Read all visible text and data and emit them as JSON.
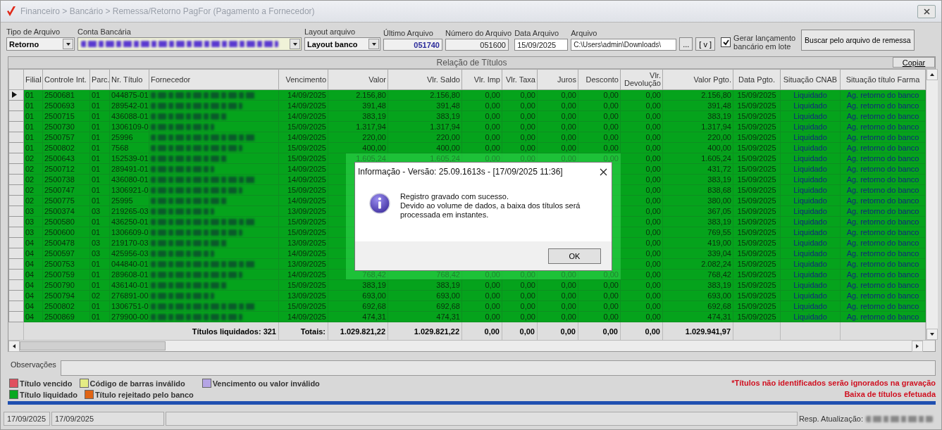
{
  "window": {
    "title": "Financeiro > Bancário > Remessa/Retorno PagFor (Pagamento  a Fornecedor)"
  },
  "filters": {
    "tipo_arquivo": {
      "label": "Tipo de Arquivo",
      "value": "Retorno"
    },
    "conta_bancaria": {
      "label": "Conta Bancária"
    },
    "layout_arquivo": {
      "label": "Layout arquivo",
      "value": "Layout banco"
    },
    "ultimo_arquivo": {
      "label": "Último Arquivo",
      "value": "051740"
    },
    "numero_arquivo": {
      "label": "Número do Arquivo",
      "value": "051600"
    },
    "data_arquivo": {
      "label": "Data Arquivo",
      "value": "15/09/2025"
    },
    "arquivo": {
      "label": "Arquivo",
      "value": "C:\\Users\\admin\\Downloads\\"
    },
    "browse_button": "...",
    "view_button": "[ v ]",
    "gerar_lote": {
      "label": "Gerar lançamento bancário em lote",
      "checked": true
    },
    "buscar_button": "Buscar pelo arquivo de remessa"
  },
  "table": {
    "title": "Relação de Títulos",
    "copy_button": "Copiar",
    "columns": [
      {
        "label": "Filial"
      },
      {
        "label": "Controle Int."
      },
      {
        "label": "Parc."
      },
      {
        "label": "Nr. Título"
      },
      {
        "label": "Fornecedor"
      },
      {
        "label": "Vencimento"
      },
      {
        "label": "Valor"
      },
      {
        "label": "Vlr. Saldo"
      },
      {
        "label": "Vlr. Imp"
      },
      {
        "label": "Vlr. Taxa"
      },
      {
        "label": "Juros"
      },
      {
        "label": "Desconto"
      },
      {
        "label": "Vlr. Devolução"
      },
      {
        "label": "Valor Pgto."
      },
      {
        "label": "Data Pgto."
      },
      {
        "label": "Situação CNAB"
      },
      {
        "label": "Situação título Farma"
      }
    ],
    "rows": [
      {
        "selected": true,
        "cells": [
          "01",
          "2500681",
          "01",
          "044875-01",
          null,
          "14/09/2025",
          "2.156,80",
          "2.156,80",
          "0,00",
          "0,00",
          "0,00",
          "0,00",
          "0,00",
          "2.156,80",
          "15/09/2025",
          "Liquidado",
          "Ag. retorno do banco"
        ]
      },
      {
        "selected": false,
        "cells": [
          "01",
          "2500693",
          "01",
          "289542-01",
          null,
          "14/09/2025",
          "391,48",
          "391,48",
          "0,00",
          "0,00",
          "0,00",
          "0,00",
          "0,00",
          "391,48",
          "15/09/2025",
          "Liquidado",
          "Ag. retorno do banco"
        ]
      },
      {
        "selected": false,
        "cells": [
          "01",
          "2500715",
          "01",
          "436088-01",
          null,
          "14/09/2025",
          "383,19",
          "383,19",
          "0,00",
          "0,00",
          "0,00",
          "0,00",
          "0,00",
          "383,19",
          "15/09/2025",
          "Liquidado",
          "Ag. retorno do banco"
        ]
      },
      {
        "selected": false,
        "cells": [
          "01",
          "2500730",
          "01",
          "1306109-0",
          null,
          "15/09/2025",
          "1.317,94",
          "1.317,94",
          "0,00",
          "0,00",
          "0,00",
          "0,00",
          "0,00",
          "1.317,94",
          "15/09/2025",
          "Liquidado",
          "Ag. retorno do banco"
        ]
      },
      {
        "selected": false,
        "cells": [
          "01",
          "2500757",
          "01",
          "25996",
          null,
          "14/09/2025",
          "220,00",
          "220,00",
          "0,00",
          "0,00",
          "0,00",
          "0,00",
          "0,00",
          "220,00",
          "15/09/2025",
          "Liquidado",
          "Ag. retorno do banco"
        ]
      },
      {
        "selected": false,
        "cells": [
          "01",
          "2500802",
          "01",
          "7568",
          null,
          "15/09/2025",
          "400,00",
          "400,00",
          "0,00",
          "0,00",
          "0,00",
          "0,00",
          "0,00",
          "400,00",
          "15/09/2025",
          "Liquidado",
          "Ag. retorno do banco"
        ]
      },
      {
        "selected": false,
        "cells": [
          "02",
          "2500643",
          "01",
          "152539-01",
          null,
          "15/09/2025",
          "1.605,24",
          "1.605,24",
          "0,00",
          "0,00",
          "0,00",
          "0,00",
          "0,00",
          "1.605,24",
          "15/09/2025",
          "Liquidado",
          "Ag. retorno do banco"
        ]
      },
      {
        "selected": false,
        "cells": [
          "02",
          "2500712",
          "01",
          "289491-01",
          null,
          "14/09/2025",
          null,
          null,
          null,
          null,
          null,
          null,
          "0,00",
          "431,72",
          "15/09/2025",
          "Liquidado",
          "Ag. retorno do banco"
        ]
      },
      {
        "selected": false,
        "cells": [
          "02",
          "2500738",
          "01",
          "436080-01",
          null,
          "14/09/2025",
          null,
          null,
          null,
          null,
          null,
          null,
          "0,00",
          "383,19",
          "15/09/2025",
          "Liquidado",
          "Ag. retorno do banco"
        ]
      },
      {
        "selected": false,
        "cells": [
          "02",
          "2500747",
          "01",
          "1306921-0",
          null,
          "15/09/2025",
          null,
          null,
          null,
          null,
          null,
          null,
          "0,00",
          "838,68",
          "15/09/2025",
          "Liquidado",
          "Ag. retorno do banco"
        ]
      },
      {
        "selected": false,
        "cells": [
          "02",
          "2500775",
          "01",
          "25995",
          null,
          "14/09/2025",
          null,
          null,
          null,
          null,
          null,
          null,
          "0,00",
          "380,00",
          "15/09/2025",
          "Liquidado",
          "Ag. retorno do banco"
        ]
      },
      {
        "selected": false,
        "cells": [
          "03",
          "2500374",
          "03",
          "219265-03",
          null,
          "13/09/2025",
          null,
          null,
          null,
          null,
          null,
          null,
          "0,00",
          "367,05",
          "15/09/2025",
          "Liquidado",
          "Ag. retorno do banco"
        ]
      },
      {
        "selected": false,
        "cells": [
          "03",
          "2500580",
          "01",
          "436250-01",
          null,
          "15/09/2025",
          null,
          null,
          null,
          null,
          null,
          null,
          "0,00",
          "383,19",
          "15/09/2025",
          "Liquidado",
          "Ag. retorno do banco"
        ]
      },
      {
        "selected": false,
        "cells": [
          "03",
          "2500600",
          "01",
          "1306609-0",
          null,
          "15/09/2025",
          null,
          null,
          null,
          null,
          null,
          null,
          "0,00",
          "769,55",
          "15/09/2025",
          "Liquidado",
          "Ag. retorno do banco"
        ]
      },
      {
        "selected": false,
        "cells": [
          "04",
          "2500478",
          "03",
          "219170-03",
          null,
          "13/09/2025",
          null,
          null,
          null,
          null,
          null,
          null,
          "0,00",
          "419,00",
          "15/09/2025",
          "Liquidado",
          "Ag. retorno do banco"
        ]
      },
      {
        "selected": false,
        "cells": [
          "04",
          "2500597",
          "03",
          "425956-03",
          null,
          "14/09/2025",
          null,
          null,
          null,
          null,
          null,
          null,
          "0,00",
          "339,04",
          "15/09/2025",
          "Liquidado",
          "Ag. retorno do banco"
        ]
      },
      {
        "selected": false,
        "cells": [
          "04",
          "2500753",
          "01",
          "044840-01",
          null,
          "13/09/2025",
          null,
          null,
          null,
          null,
          null,
          null,
          "0,00",
          "2.082,24",
          "15/09/2025",
          "Liquidado",
          "Ag. retorno do banco"
        ]
      },
      {
        "selected": false,
        "cells": [
          "04",
          "2500759",
          "01",
          "289608-01",
          null,
          "14/09/2025",
          "768,42",
          "768,42",
          "0,00",
          "0,00",
          "0,00",
          "0,00",
          "0,00",
          "768,42",
          "15/09/2025",
          "Liquidado",
          "Ag. retorno do banco"
        ]
      },
      {
        "selected": false,
        "cells": [
          "04",
          "2500790",
          "01",
          "436140-01",
          null,
          "15/09/2025",
          "383,19",
          "383,19",
          "0,00",
          "0,00",
          "0,00",
          "0,00",
          "0,00",
          "383,19",
          "15/09/2025",
          "Liquidado",
          "Ag. retorno do banco"
        ]
      },
      {
        "selected": false,
        "cells": [
          "04",
          "2500794",
          "02",
          "276891-00",
          null,
          "13/09/2025",
          "693,00",
          "693,00",
          "0,00",
          "0,00",
          "0,00",
          "0,00",
          "0,00",
          "693,00",
          "15/09/2025",
          "Liquidado",
          "Ag. retorno do banco"
        ]
      },
      {
        "selected": false,
        "cells": [
          "04",
          "2500802",
          "01",
          "1306751-0",
          null,
          "15/09/2025",
          "692,68",
          "692,68",
          "0,00",
          "0,00",
          "0,00",
          "0,00",
          "0,00",
          "692,68",
          "15/09/2025",
          "Liquidado",
          "Ag. retorno do banco"
        ]
      },
      {
        "selected": false,
        "cells": [
          "04",
          "2500869",
          "01",
          "279900-00",
          null,
          "14/09/2025",
          "474,31",
          "474,31",
          "0,00",
          "0,00",
          "0,00",
          "0,00",
          "0,00",
          "474,31",
          "15/09/2025",
          "Liquidado",
          "Ag. retorno do banco"
        ]
      }
    ],
    "totals": {
      "count": "Títulos liquidados: 321",
      "label": "Totais:",
      "values": [
        "1.029.821,22",
        "1.029.821,22",
        "0,00",
        "0,00",
        "0,00",
        "0,00",
        "0,00",
        "1.029.941,97"
      ]
    }
  },
  "observacoes": {
    "label": "Observações"
  },
  "legend": [
    {
      "label": "Título vencido",
      "color": "#e0505f"
    },
    {
      "label": "Código de barras inválido",
      "color": "#e4ec84"
    },
    {
      "label": "Vencimento ou valor inválido",
      "color": "#b4a4e4"
    },
    {
      "label": "Título liquidado",
      "color": "#08a820"
    },
    {
      "label": "Título rejeitado pelo banco",
      "color": "#e06414"
    }
  ],
  "notes": [
    "*Títulos não identificados serão ignorados na gravação",
    "Baixa de títulos efetuada"
  ],
  "status_bar": {
    "dates": [
      "17/09/2025",
      "17/09/2025"
    ],
    "resp_label": "Resp. Atualização:"
  },
  "dialog": {
    "title": "Informação - Versão: 25.09.1613s - [17/09/2025 11:36]",
    "message": "Registro gravado com sucesso.\nDevido ao volume de dados, a baixa dos títulos será processada em instantes.",
    "ok_button": "OK"
  }
}
